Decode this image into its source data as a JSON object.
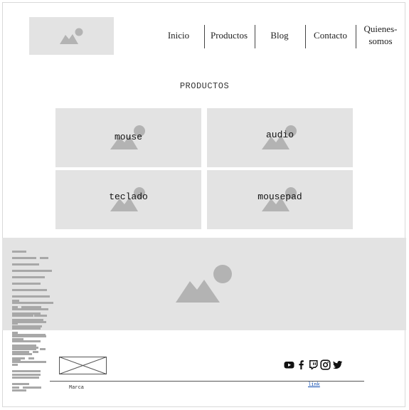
{
  "nav": {
    "items": [
      "Inicio",
      "Productos",
      "Blog",
      "Contacto",
      "Quienes-\nsomos"
    ]
  },
  "products": {
    "title": "PRODUCTOS",
    "cards": [
      "mouse",
      "audio",
      "teclado",
      "mousepad"
    ]
  },
  "footer": {
    "brand": "Marca",
    "link": "link",
    "social_icons": [
      "youtube-icon",
      "facebook-icon",
      "twitch-icon",
      "instagram-icon",
      "twitter-icon"
    ]
  },
  "colors": {
    "placeholder_bg": "#e3e3e3",
    "placeholder_icon": "#b3b3b3",
    "link": "#0645ad"
  }
}
